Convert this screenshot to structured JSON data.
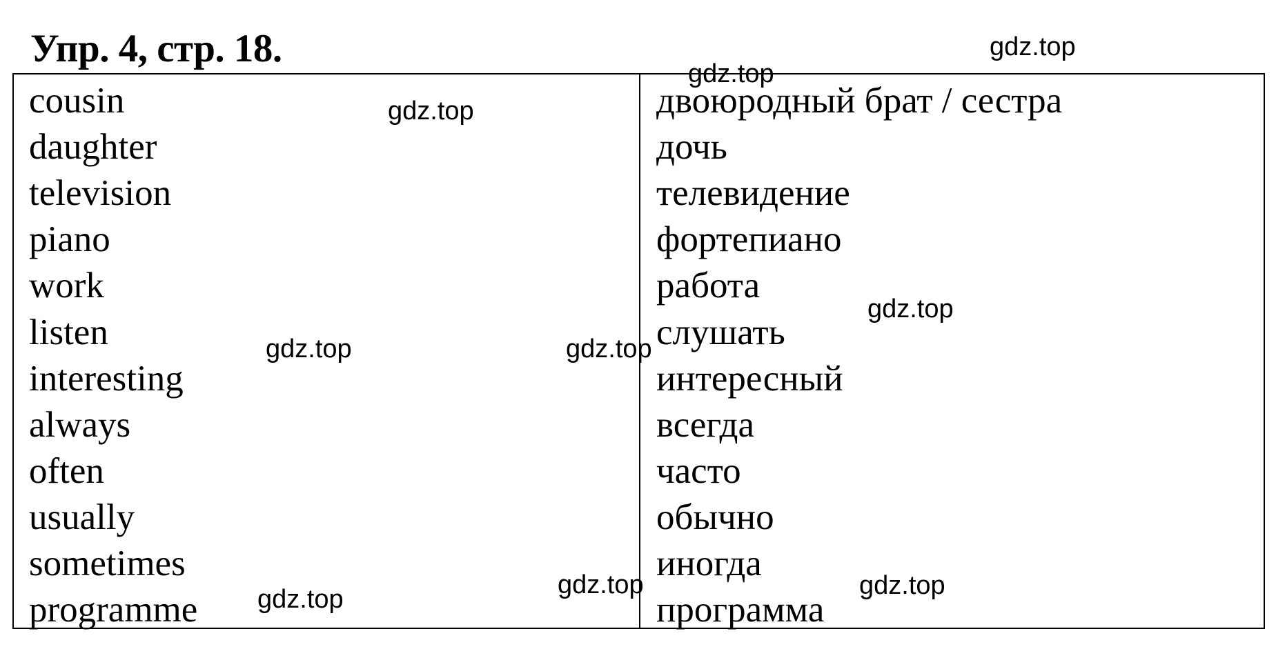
{
  "title": "Упр. 4, стр. 18.",
  "vocabulary": {
    "english": [
      "cousin",
      "daughter",
      "television",
      "piano",
      "work",
      "listen",
      "interesting",
      "always",
      "often",
      "usually",
      "sometimes",
      "programme"
    ],
    "russian": [
      "двоюродный брат / сестра",
      "дочь",
      "телевидение",
      "фортепиано",
      "работа",
      "слушать",
      "интересный",
      "всегда",
      "часто",
      "обычно",
      "иногда",
      "программа"
    ]
  },
  "watermarks": [
    "gdz.top",
    "gdz.top",
    "gdz.top",
    "gdz.top",
    "gdz.top",
    "gdz.top",
    "gdz.top",
    "gdz.top",
    "gdz.top"
  ]
}
